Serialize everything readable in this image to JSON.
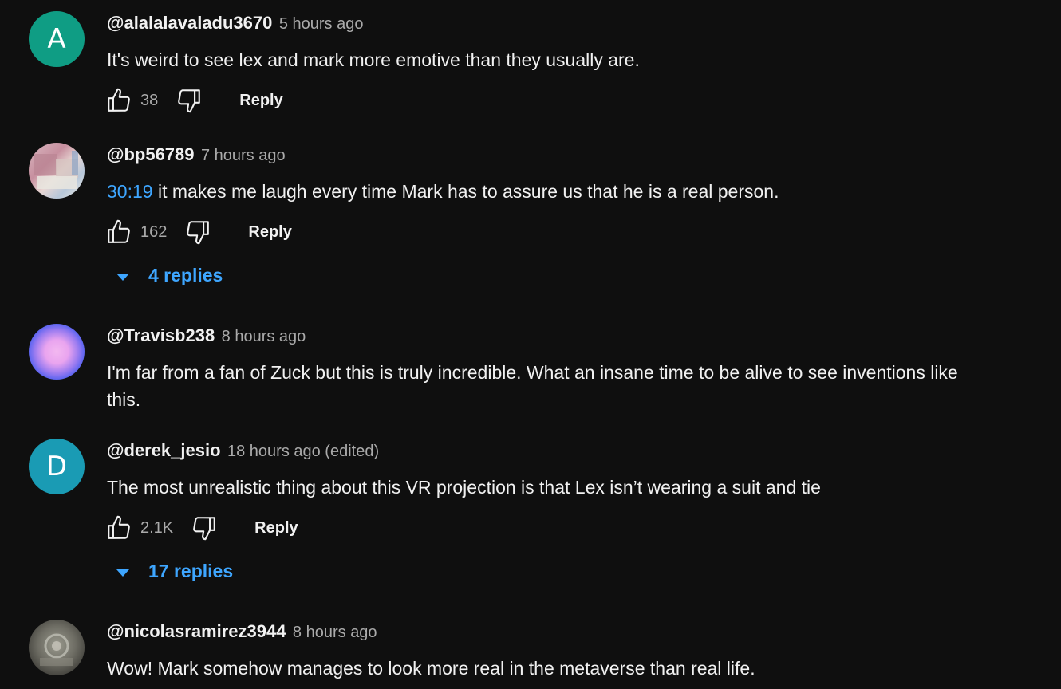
{
  "comments": [
    {
      "author": "@alalalavaladu3670",
      "time": "5 hours ago",
      "avatar_letter": "A",
      "avatar_color": "#0f9d84",
      "timestamp_link": "",
      "text": "It's weird to see lex and mark more emotive than they usually are.",
      "likes": "38",
      "reply_label": "Reply"
    },
    {
      "author": "@bp56789",
      "time": "7 hours ago",
      "timestamp_link": "30:19",
      "text": " it makes me laugh every time Mark has to assure us that he is a real person.",
      "likes": "162",
      "reply_label": "Reply",
      "replies_label": "4 replies"
    },
    {
      "author": "@Travisb238",
      "time": "8 hours ago",
      "timestamp_link": "",
      "text": "I'm far from a fan of Zuck but this is truly incredible. What an insane time to be alive to see inventions like this."
    },
    {
      "author": "@derek_jesio",
      "time": "18 hours ago (edited)",
      "avatar_letter": "D",
      "avatar_color": "#1a9bb4",
      "timestamp_link": "",
      "text": "The most unrealistic thing about this VR projection is that Lex isn’t wearing a suit and tie",
      "likes": "2.1K",
      "reply_label": "Reply",
      "replies_label": "17 replies"
    },
    {
      "author": "@nicolasramirez3944",
      "time": "8 hours ago",
      "timestamp_link": "",
      "text": "Wow! Mark somehow manages to look more real in the metaverse than real life."
    }
  ],
  "colors": {
    "background": "#0f0f0f",
    "link": "#3ea6ff",
    "secondary_text": "#aaaaaa"
  }
}
